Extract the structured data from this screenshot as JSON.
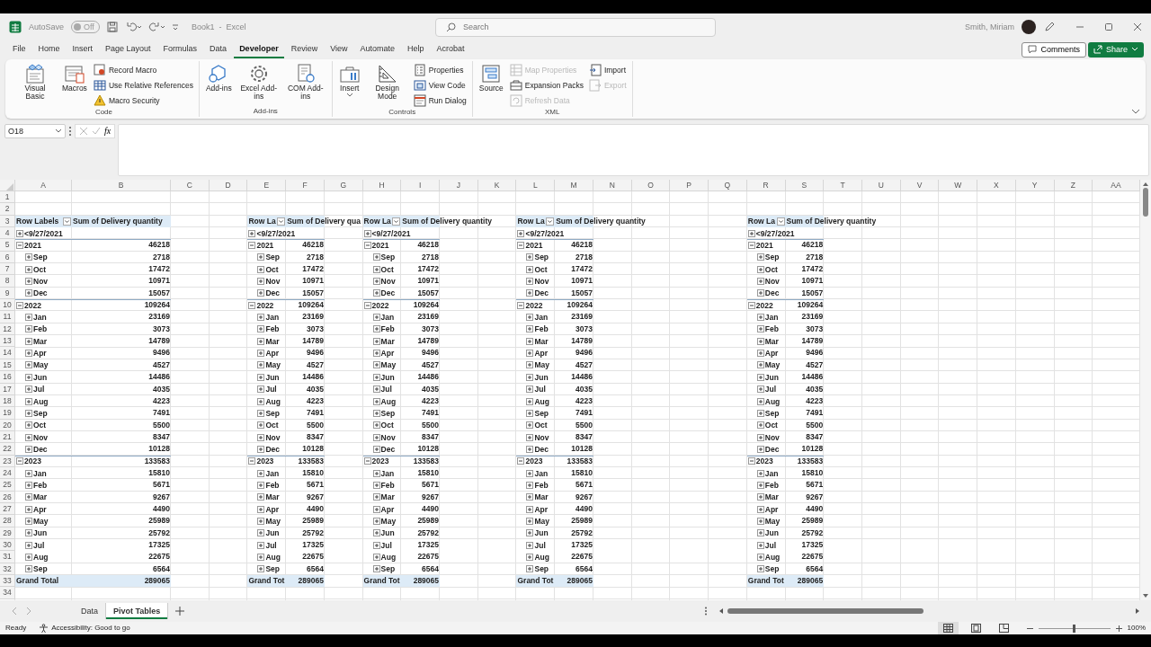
{
  "title_bar": {
    "autosave_label": "AutoSave",
    "autosave_toggle": {
      "label": "Off",
      "on": false
    },
    "document_title": "Book1  -  Excel",
    "search": {
      "placeholder": "Search"
    },
    "user_name": "Smith, Miriam"
  },
  "ribbon_tabs": [
    {
      "label": "File",
      "selected": false
    },
    {
      "label": "Home",
      "selected": false
    },
    {
      "label": "Insert",
      "selected": false
    },
    {
      "label": "Page Layout",
      "selected": false
    },
    {
      "label": "Formulas",
      "selected": false
    },
    {
      "label": "Data",
      "selected": false
    },
    {
      "label": "Developer",
      "selected": true
    },
    {
      "label": "Review",
      "selected": false
    },
    {
      "label": "View",
      "selected": false
    },
    {
      "label": "Automate",
      "selected": false
    },
    {
      "label": "Help",
      "selected": false
    },
    {
      "label": "Acrobat",
      "selected": false
    }
  ],
  "comments_button": "Comments",
  "share_button": "Share",
  "ribbon_groups": [
    {
      "name": "Code",
      "items": [
        {
          "label": "Visual Basic",
          "kind": "large",
          "disabled": false
        },
        {
          "label": "Macros",
          "kind": "large",
          "disabled": false
        },
        {
          "label": "Record Macro",
          "kind": "small",
          "disabled": false
        },
        {
          "label": "Use Relative References",
          "kind": "small",
          "disabled": false
        },
        {
          "label": "Macro Security",
          "kind": "small",
          "disabled": false
        }
      ]
    },
    {
      "name": "Add-ins",
      "items": [
        {
          "label": "Add-ins",
          "kind": "large",
          "disabled": false
        },
        {
          "label": "Excel Add-ins",
          "kind": "large",
          "disabled": false
        },
        {
          "label": "COM Add-ins",
          "kind": "large",
          "disabled": false
        }
      ]
    },
    {
      "name": "Controls",
      "items": [
        {
          "label": "Insert",
          "kind": "dropdown",
          "disabled": false
        },
        {
          "label": "Design Mode",
          "kind": "large",
          "disabled": false
        },
        {
          "label": "Properties",
          "kind": "small",
          "disabled": false
        },
        {
          "label": "View Code",
          "kind": "small",
          "disabled": false
        },
        {
          "label": "Run Dialog",
          "kind": "small",
          "disabled": false
        }
      ]
    },
    {
      "name": "XML",
      "items": [
        {
          "label": "Source",
          "kind": "large",
          "disabled": false
        },
        {
          "label": "Map Properties",
          "kind": "small",
          "disabled": true
        },
        {
          "label": "Expansion Packs",
          "kind": "small",
          "disabled": false
        },
        {
          "label": "Refresh Data",
          "kind": "small",
          "disabled": true
        },
        {
          "label": "Import",
          "kind": "small",
          "disabled": false
        },
        {
          "label": "Export",
          "kind": "small",
          "disabled": true
        }
      ]
    }
  ],
  "formula_bar": {
    "name_box": "O18",
    "function_button": "fx"
  },
  "columns": [
    "A",
    "B",
    "C",
    "D",
    "E",
    "F",
    "G",
    "H",
    "I",
    "J",
    "K",
    "L",
    "M",
    "N",
    "O",
    "P",
    "Q",
    "R",
    "S",
    "T",
    "U",
    "V",
    "W",
    "X",
    "Y",
    "Z",
    "AA"
  ],
  "row_numbers": [
    "1",
    "2",
    "3",
    "4",
    "5",
    "6",
    "7",
    "8",
    "9",
    "10",
    "11",
    "12",
    "13",
    "14",
    "15",
    "16",
    "17",
    "18",
    "19",
    "20",
    "21",
    "22",
    "23",
    "24",
    "25",
    "26",
    "27",
    "28",
    "29",
    "30",
    "31",
    "32",
    "33",
    "34"
  ],
  "pivot_tables": [
    {
      "row_label_header": "Row Labels",
      "value_header": "Sum of Delivery quantity",
      "grand_total_label": "Grand Total",
      "grand_total": "289065",
      "rows": [
        {
          "label": "<9/27/2021",
          "expanded": false
        },
        {
          "label": "2021",
          "value": "46218",
          "expanded": true,
          "children": [
            {
              "label": "Sep",
              "value": "2718",
              "expanded": false
            },
            {
              "label": "Oct",
              "value": "17472",
              "expanded": false
            },
            {
              "label": "Nov",
              "value": "10971",
              "expanded": false
            },
            {
              "label": "Dec",
              "value": "15057",
              "expanded": false
            }
          ]
        },
        {
          "label": "2022",
          "value": "109264",
          "expanded": true,
          "children": [
            {
              "label": "Jan",
              "value": "23169",
              "expanded": false
            },
            {
              "label": "Feb",
              "value": "3073",
              "expanded": false
            },
            {
              "label": "Mar",
              "value": "14789",
              "expanded": false
            },
            {
              "label": "Apr",
              "value": "9496",
              "expanded": false
            },
            {
              "label": "May",
              "value": "4527",
              "expanded": false
            },
            {
              "label": "Jun",
              "value": "14486",
              "expanded": false
            },
            {
              "label": "Jul",
              "value": "4035",
              "expanded": false
            },
            {
              "label": "Aug",
              "value": "4223",
              "expanded": false
            },
            {
              "label": "Sep",
              "value": "7491",
              "expanded": false
            },
            {
              "label": "Oct",
              "value": "5500",
              "expanded": false
            },
            {
              "label": "Nov",
              "value": "8347",
              "expanded": false
            },
            {
              "label": "Dec",
              "value": "10128",
              "expanded": false
            }
          ]
        },
        {
          "label": "2023",
          "value": "133583",
          "expanded": true,
          "children": [
            {
              "label": "Jan",
              "value": "15810",
              "expanded": false
            },
            {
              "label": "Feb",
              "value": "5671",
              "expanded": false
            },
            {
              "label": "Mar",
              "value": "9267",
              "expanded": false
            },
            {
              "label": "Apr",
              "value": "4490",
              "expanded": false
            },
            {
              "label": "May",
              "value": "25989",
              "expanded": false
            },
            {
              "label": "Jun",
              "value": "25792",
              "expanded": false
            },
            {
              "label": "Jul",
              "value": "17325",
              "expanded": false
            },
            {
              "label": "Aug",
              "value": "22675",
              "expanded": false
            },
            {
              "label": "Sep",
              "value": "6564",
              "expanded": false
            }
          ]
        }
      ]
    },
    {
      "row_label_header": "Row La",
      "value_header": "Sum of Delivery qua",
      "grand_total_label": "Grand Tot",
      "grand_total": "289065",
      "rows": [
        {
          "label": "<9/27/2021",
          "expanded": false
        },
        {
          "label": "2021",
          "value": "46218",
          "expanded": true,
          "children": [
            {
              "label": "Sep",
              "value": "2718",
              "expanded": false
            },
            {
              "label": "Oct",
              "value": "17472",
              "expanded": false
            },
            {
              "label": "Nov",
              "value": "10971",
              "expanded": false
            },
            {
              "label": "Dec",
              "value": "15057",
              "expanded": false
            }
          ]
        },
        {
          "label": "2022",
          "value": "109264",
          "expanded": true,
          "children": [
            {
              "label": "Jan",
              "value": "23169",
              "expanded": false
            },
            {
              "label": "Feb",
              "value": "3073",
              "expanded": false
            },
            {
              "label": "Mar",
              "value": "14789",
              "expanded": false
            },
            {
              "label": "Apr",
              "value": "9496",
              "expanded": false
            },
            {
              "label": "May",
              "value": "4527",
              "expanded": false
            },
            {
              "label": "Jun",
              "value": "14486",
              "expanded": false
            },
            {
              "label": "Jul",
              "value": "4035",
              "expanded": false
            },
            {
              "label": "Aug",
              "value": "4223",
              "expanded": false
            },
            {
              "label": "Sep",
              "value": "7491",
              "expanded": false
            },
            {
              "label": "Oct",
              "value": "5500",
              "expanded": false
            },
            {
              "label": "Nov",
              "value": "8347",
              "expanded": false
            },
            {
              "label": "Dec",
              "value": "10128",
              "expanded": false
            }
          ]
        },
        {
          "label": "2023",
          "value": "133583",
          "expanded": true,
          "children": [
            {
              "label": "Jan",
              "value": "15810",
              "expanded": false
            },
            {
              "label": "Feb",
              "value": "5671",
              "expanded": false
            },
            {
              "label": "Mar",
              "value": "9267",
              "expanded": false
            },
            {
              "label": "Apr",
              "value": "4490",
              "expanded": false
            },
            {
              "label": "May",
              "value": "25989",
              "expanded": false
            },
            {
              "label": "Jun",
              "value": "25792",
              "expanded": false
            },
            {
              "label": "Jul",
              "value": "17325",
              "expanded": false
            },
            {
              "label": "Aug",
              "value": "22675",
              "expanded": false
            },
            {
              "label": "Sep",
              "value": "6564",
              "expanded": false
            }
          ]
        }
      ]
    },
    {
      "row_label_header": "Row La",
      "value_header": "Sum of Delivery quantity",
      "grand_total_label": "Grand Tot",
      "grand_total": "289065",
      "rows": [
        {
          "label": "<9/27/2021",
          "expanded": false
        },
        {
          "label": "2021",
          "value": "46218",
          "expanded": true,
          "children": [
            {
              "label": "Sep",
              "value": "2718",
              "expanded": false
            },
            {
              "label": "Oct",
              "value": "17472",
              "expanded": false
            },
            {
              "label": "Nov",
              "value": "10971",
              "expanded": false
            },
            {
              "label": "Dec",
              "value": "15057",
              "expanded": false
            }
          ]
        },
        {
          "label": "2022",
          "value": "109264",
          "expanded": true,
          "children": [
            {
              "label": "Jan",
              "value": "23169",
              "expanded": false
            },
            {
              "label": "Feb",
              "value": "3073",
              "expanded": false
            },
            {
              "label": "Mar",
              "value": "14789",
              "expanded": false
            },
            {
              "label": "Apr",
              "value": "9496",
              "expanded": false
            },
            {
              "label": "May",
              "value": "4527",
              "expanded": false
            },
            {
              "label": "Jun",
              "value": "14486",
              "expanded": false
            },
            {
              "label": "Jul",
              "value": "4035",
              "expanded": false
            },
            {
              "label": "Aug",
              "value": "4223",
              "expanded": false
            },
            {
              "label": "Sep",
              "value": "7491",
              "expanded": false
            },
            {
              "label": "Oct",
              "value": "5500",
              "expanded": false
            },
            {
              "label": "Nov",
              "value": "8347",
              "expanded": false
            },
            {
              "label": "Dec",
              "value": "10128",
              "expanded": false
            }
          ]
        },
        {
          "label": "2023",
          "value": "133583",
          "expanded": true,
          "children": [
            {
              "label": "Jan",
              "value": "15810",
              "expanded": false
            },
            {
              "label": "Feb",
              "value": "5671",
              "expanded": false
            },
            {
              "label": "Mar",
              "value": "9267",
              "expanded": false
            },
            {
              "label": "Apr",
              "value": "4490",
              "expanded": false
            },
            {
              "label": "May",
              "value": "25989",
              "expanded": false
            },
            {
              "label": "Jun",
              "value": "25792",
              "expanded": false
            },
            {
              "label": "Jul",
              "value": "17325",
              "expanded": false
            },
            {
              "label": "Aug",
              "value": "22675",
              "expanded": false
            },
            {
              "label": "Sep",
              "value": "6564",
              "expanded": false
            }
          ]
        }
      ]
    },
    {
      "row_label_header": "Row La",
      "value_header": "Sum of Delivery quantity",
      "grand_total_label": "Grand Tot",
      "grand_total": "289065",
      "rows": [
        {
          "label": "<9/27/2021",
          "expanded": false
        },
        {
          "label": "2021",
          "value": "46218",
          "expanded": true,
          "children": [
            {
              "label": "Sep",
              "value": "2718",
              "expanded": false
            },
            {
              "label": "Oct",
              "value": "17472",
              "expanded": false
            },
            {
              "label": "Nov",
              "value": "10971",
              "expanded": false
            },
            {
              "label": "Dec",
              "value": "15057",
              "expanded": false
            }
          ]
        },
        {
          "label": "2022",
          "value": "109264",
          "expanded": true,
          "children": [
            {
              "label": "Jan",
              "value": "23169",
              "expanded": false
            },
            {
              "label": "Feb",
              "value": "3073",
              "expanded": false
            },
            {
              "label": "Mar",
              "value": "14789",
              "expanded": false
            },
            {
              "label": "Apr",
              "value": "9496",
              "expanded": false
            },
            {
              "label": "May",
              "value": "4527",
              "expanded": false
            },
            {
              "label": "Jun",
              "value": "14486",
              "expanded": false
            },
            {
              "label": "Jul",
              "value": "4035",
              "expanded": false
            },
            {
              "label": "Aug",
              "value": "4223",
              "expanded": false
            },
            {
              "label": "Sep",
              "value": "7491",
              "expanded": false
            },
            {
              "label": "Oct",
              "value": "5500",
              "expanded": false
            },
            {
              "label": "Nov",
              "value": "8347",
              "expanded": false
            },
            {
              "label": "Dec",
              "value": "10128",
              "expanded": false
            }
          ]
        },
        {
          "label": "2023",
          "value": "133583",
          "expanded": true,
          "children": [
            {
              "label": "Jan",
              "value": "15810",
              "expanded": false
            },
            {
              "label": "Feb",
              "value": "5671",
              "expanded": false
            },
            {
              "label": "Mar",
              "value": "9267",
              "expanded": false
            },
            {
              "label": "Apr",
              "value": "4490",
              "expanded": false
            },
            {
              "label": "May",
              "value": "25989",
              "expanded": false
            },
            {
              "label": "Jun",
              "value": "25792",
              "expanded": false
            },
            {
              "label": "Jul",
              "value": "17325",
              "expanded": false
            },
            {
              "label": "Aug",
              "value": "22675",
              "expanded": false
            },
            {
              "label": "Sep",
              "value": "6564",
              "expanded": false
            }
          ]
        }
      ]
    },
    {
      "row_label_header": "Row La",
      "value_header": "Sum of Delivery quantity",
      "grand_total_label": "Grand Tot",
      "grand_total": "289065",
      "rows": [
        {
          "label": "<9/27/2021",
          "expanded": false
        },
        {
          "label": "2021",
          "value": "46218",
          "expanded": true,
          "children": [
            {
              "label": "Sep",
              "value": "2718",
              "expanded": false
            },
            {
              "label": "Oct",
              "value": "17472",
              "expanded": false
            },
            {
              "label": "Nov",
              "value": "10971",
              "expanded": false
            },
            {
              "label": "Dec",
              "value": "15057",
              "expanded": false
            }
          ]
        },
        {
          "label": "2022",
          "value": "109264",
          "expanded": true,
          "children": [
            {
              "label": "Jan",
              "value": "23169",
              "expanded": false
            },
            {
              "label": "Feb",
              "value": "3073",
              "expanded": false
            },
            {
              "label": "Mar",
              "value": "14789",
              "expanded": false
            },
            {
              "label": "Apr",
              "value": "9496",
              "expanded": false
            },
            {
              "label": "May",
              "value": "4527",
              "expanded": false
            },
            {
              "label": "Jun",
              "value": "14486",
              "expanded": false
            },
            {
              "label": "Jul",
              "value": "4035",
              "expanded": false
            },
            {
              "label": "Aug",
              "value": "4223",
              "expanded": false
            },
            {
              "label": "Sep",
              "value": "7491",
              "expanded": false
            },
            {
              "label": "Oct",
              "value": "5500",
              "expanded": false
            },
            {
              "label": "Nov",
              "value": "8347",
              "expanded": false
            },
            {
              "label": "Dec",
              "value": "10128",
              "expanded": false
            }
          ]
        },
        {
          "label": "2023",
          "value": "133583",
          "expanded": true,
          "children": [
            {
              "label": "Jan",
              "value": "15810",
              "expanded": false
            },
            {
              "label": "Feb",
              "value": "5671",
              "expanded": false
            },
            {
              "label": "Mar",
              "value": "9267",
              "expanded": false
            },
            {
              "label": "Apr",
              "value": "4490",
              "expanded": false
            },
            {
              "label": "May",
              "value": "25989",
              "expanded": false
            },
            {
              "label": "Jun",
              "value": "25792",
              "expanded": false
            },
            {
              "label": "Jul",
              "value": "17325",
              "expanded": false
            },
            {
              "label": "Aug",
              "value": "22675",
              "expanded": false
            },
            {
              "label": "Sep",
              "value": "6564",
              "expanded": false
            }
          ]
        }
      ]
    }
  ],
  "sheet_tabs": [
    {
      "label": "Data",
      "selected": false
    },
    {
      "label": "Pivot Tables",
      "selected": true
    }
  ],
  "status_bar": {
    "mode": "Ready",
    "accessibility": "Accessibility: Good to go",
    "views": [
      {
        "kind": "normal",
        "selected": true
      },
      {
        "kind": "page_layout",
        "selected": false
      },
      {
        "kind": "page_break",
        "selected": false
      }
    ],
    "zoom": {
      "level": 0.5,
      "reading": "100%"
    }
  }
}
